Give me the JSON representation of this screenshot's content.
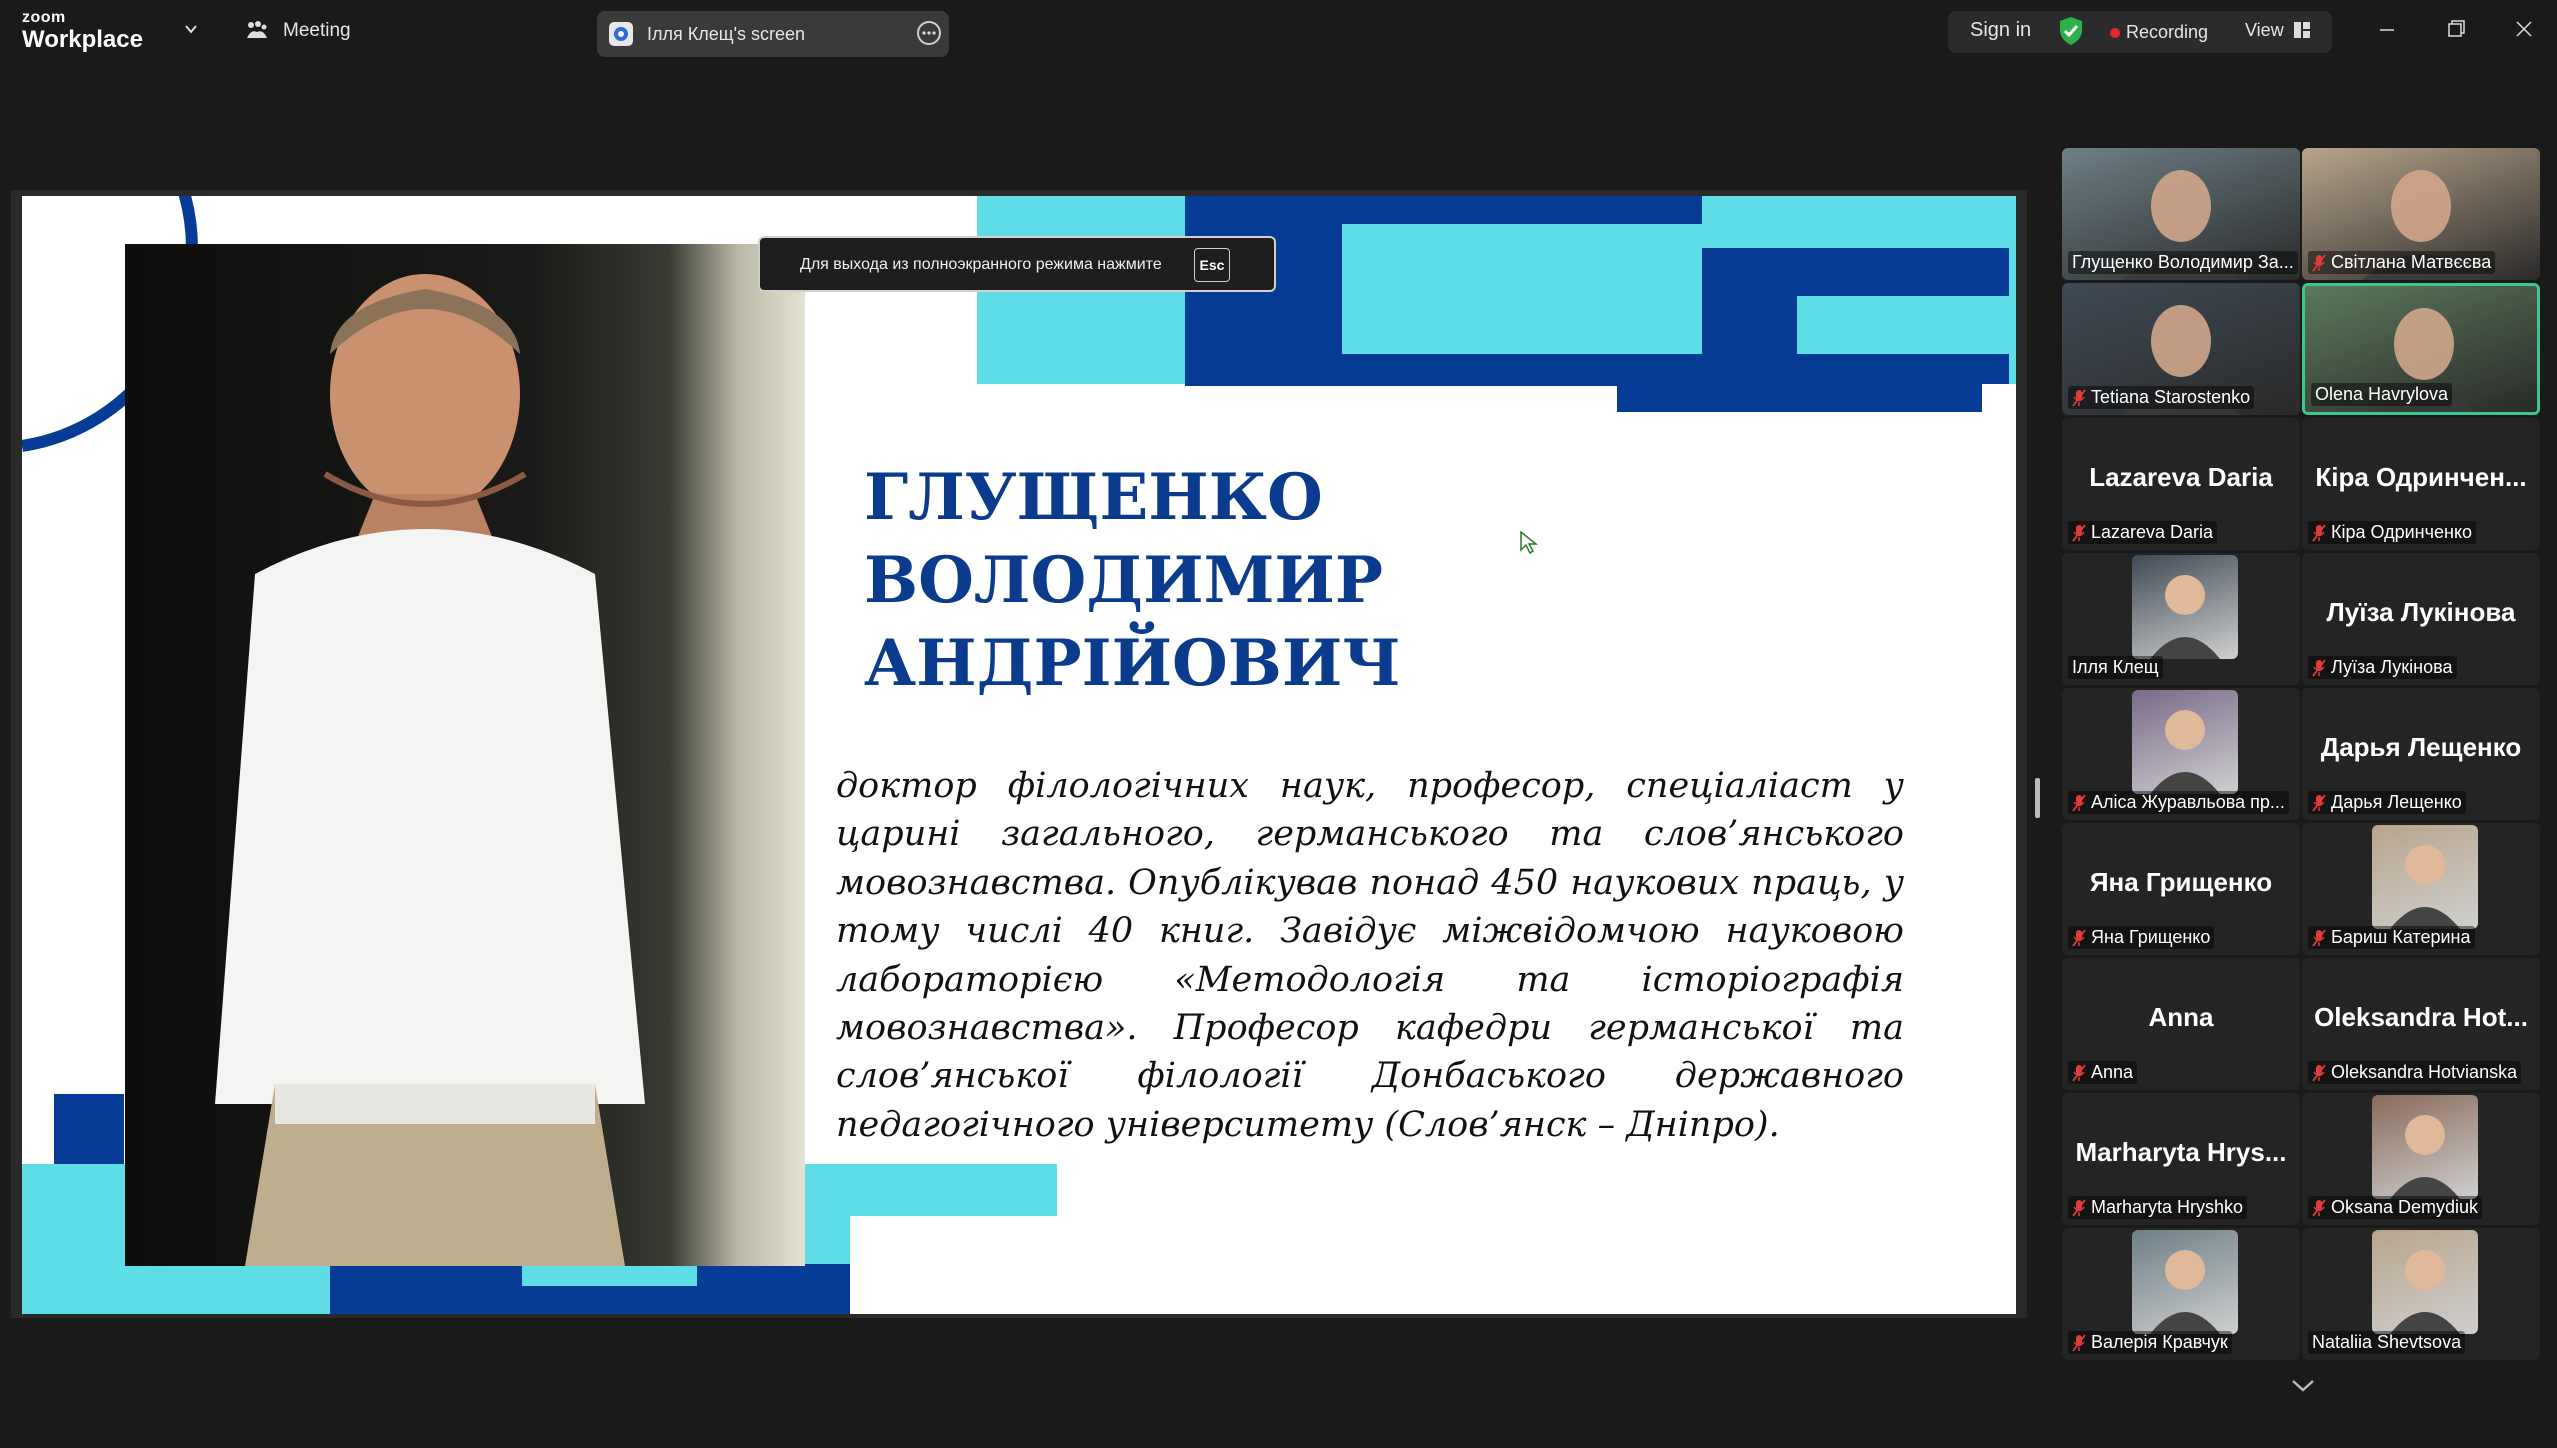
{
  "topbar": {
    "logo_small": "zoom",
    "logo_big": "Workplace",
    "meeting_label": "Meeting",
    "screen_label": "Ілля Клещ's screen",
    "sign_in": "Sign in",
    "recording": "Recording",
    "view": "View"
  },
  "slide": {
    "esc_notice": "Для выхода из полноэкранного режима нажмите",
    "esc_key": "Esc",
    "title_lines": [
      "ГЛУЩЕНКО",
      "ВОЛОДИМИР",
      "АНДРІЙОВИЧ"
    ],
    "description": "доктор філологічних наук, професор, спеціаліаст у царині загального, германського та слов’янського мовознавства. Опублікував понад 450 наукових праць, у тому числі 40 книг. Завідує міжвідомчою науковою лабораторією «Методологія та історіографія мовознавства». Професор кафедри германської та слов’янської філології Донбаського державного педагогічного університету (Слов’янск – Дніпро).",
    "colors": {
      "navy": "#063b96",
      "cyan": "#5fdde6",
      "title": "#0b3b8c"
    }
  },
  "participants": [
    {
      "label": "Глущенко Володимир За...",
      "muted": false,
      "has_video": true
    },
    {
      "label": "Світлана Матвєєва",
      "muted": true,
      "has_video": true
    },
    {
      "label": "Tetiana Starostenko",
      "muted": true,
      "has_video": true
    },
    {
      "label": "Olena Havrylova",
      "muted": false,
      "has_video": true,
      "active": true
    },
    {
      "label": "Lazareva Daria",
      "big": "Lazareva Daria",
      "muted": true
    },
    {
      "label": "Кіра Одринченко",
      "big": "Кіра  Одринчен...",
      "muted": true
    },
    {
      "label": "Ілля Клещ",
      "muted": false,
      "avatar": true
    },
    {
      "label": "Луїза Лукінова",
      "big": "Луїза Лукінова",
      "muted": true
    },
    {
      "label": "Аліса Журавльова пр...",
      "muted": true,
      "avatar": true
    },
    {
      "label": "Дарья Лещенко",
      "big": "Дарья Лещенко",
      "muted": true
    },
    {
      "label": "Яна Грищенко",
      "big": "Яна Грищенко",
      "muted": true
    },
    {
      "label": "Бариш Катерина",
      "muted": true,
      "avatar": true
    },
    {
      "label": "Anna",
      "big": "Anna",
      "muted": true
    },
    {
      "label": "Oleksandra Hotvianska",
      "big": "Oleksandra  Hot...",
      "muted": true
    },
    {
      "label": "Marharyta Hryshko",
      "big": "Marharyta  Hrys...",
      "muted": true
    },
    {
      "label": "Oksana Demydiuk",
      "muted": true,
      "avatar": true
    },
    {
      "label": "Валерія Кравчук",
      "muted": true,
      "avatar": true
    },
    {
      "label": "Nataliia Shevtsova",
      "muted": false,
      "avatar": true
    }
  ]
}
